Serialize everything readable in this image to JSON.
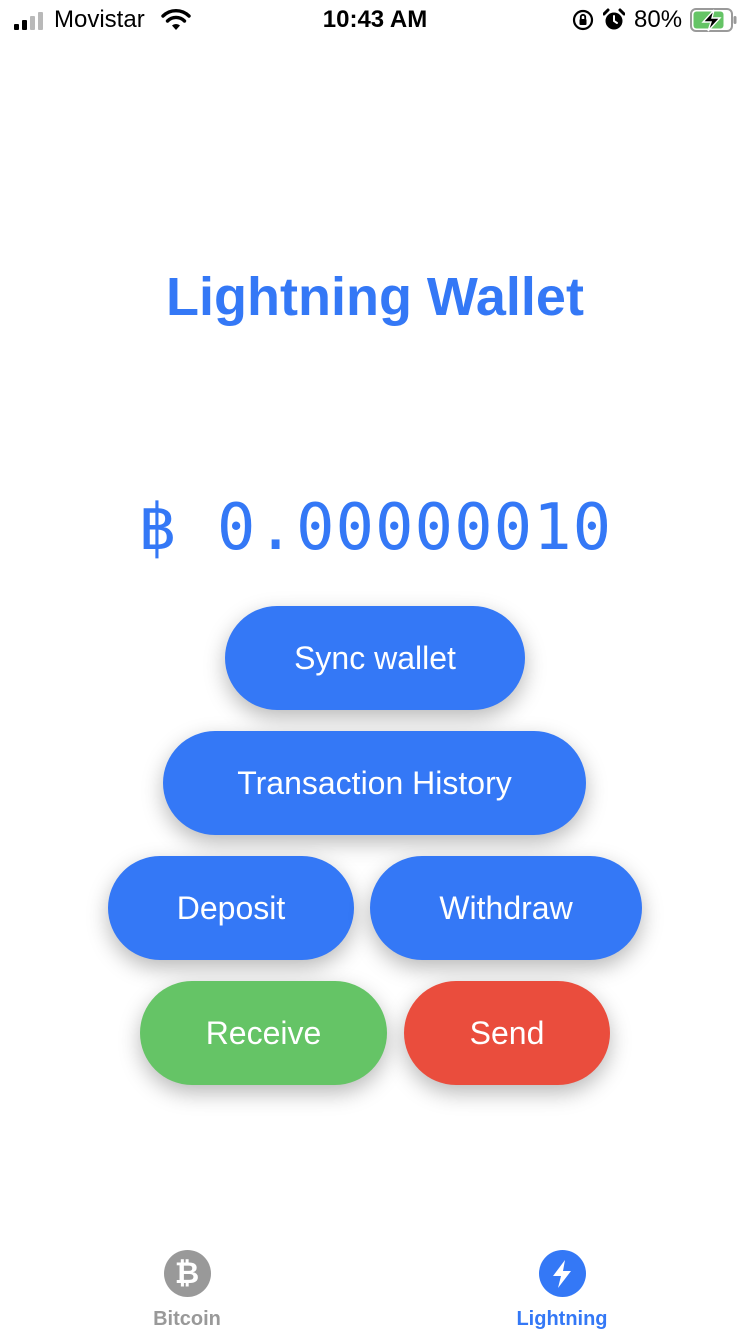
{
  "status_bar": {
    "carrier": "Movistar",
    "time": "10:43 AM",
    "battery_percent": "80%",
    "signal_icon": "cellular-signal-icon",
    "wifi_icon": "wifi-icon",
    "orientation_icon": "orientation-lock-icon",
    "alarm_icon": "alarm-clock-icon",
    "battery_icon": "battery-charging-icon"
  },
  "title": "Lightning Wallet",
  "balance": {
    "text": "฿ 0.00000010"
  },
  "buttons": {
    "sync": "Sync wallet",
    "history": "Transaction History",
    "deposit": "Deposit",
    "withdraw": "Withdraw",
    "receive": "Receive",
    "send": "Send"
  },
  "colors": {
    "accent": "#3478f6",
    "receive": "#65c466",
    "send": "#ea4d3d",
    "inactive_tab": "#999999"
  },
  "tabs": [
    {
      "label": "Bitcoin",
      "icon": "bitcoin-icon",
      "glyph": "₿",
      "active": false
    },
    {
      "label": "Lightning",
      "icon": "lightning-bolt-icon",
      "active": true
    }
  ]
}
